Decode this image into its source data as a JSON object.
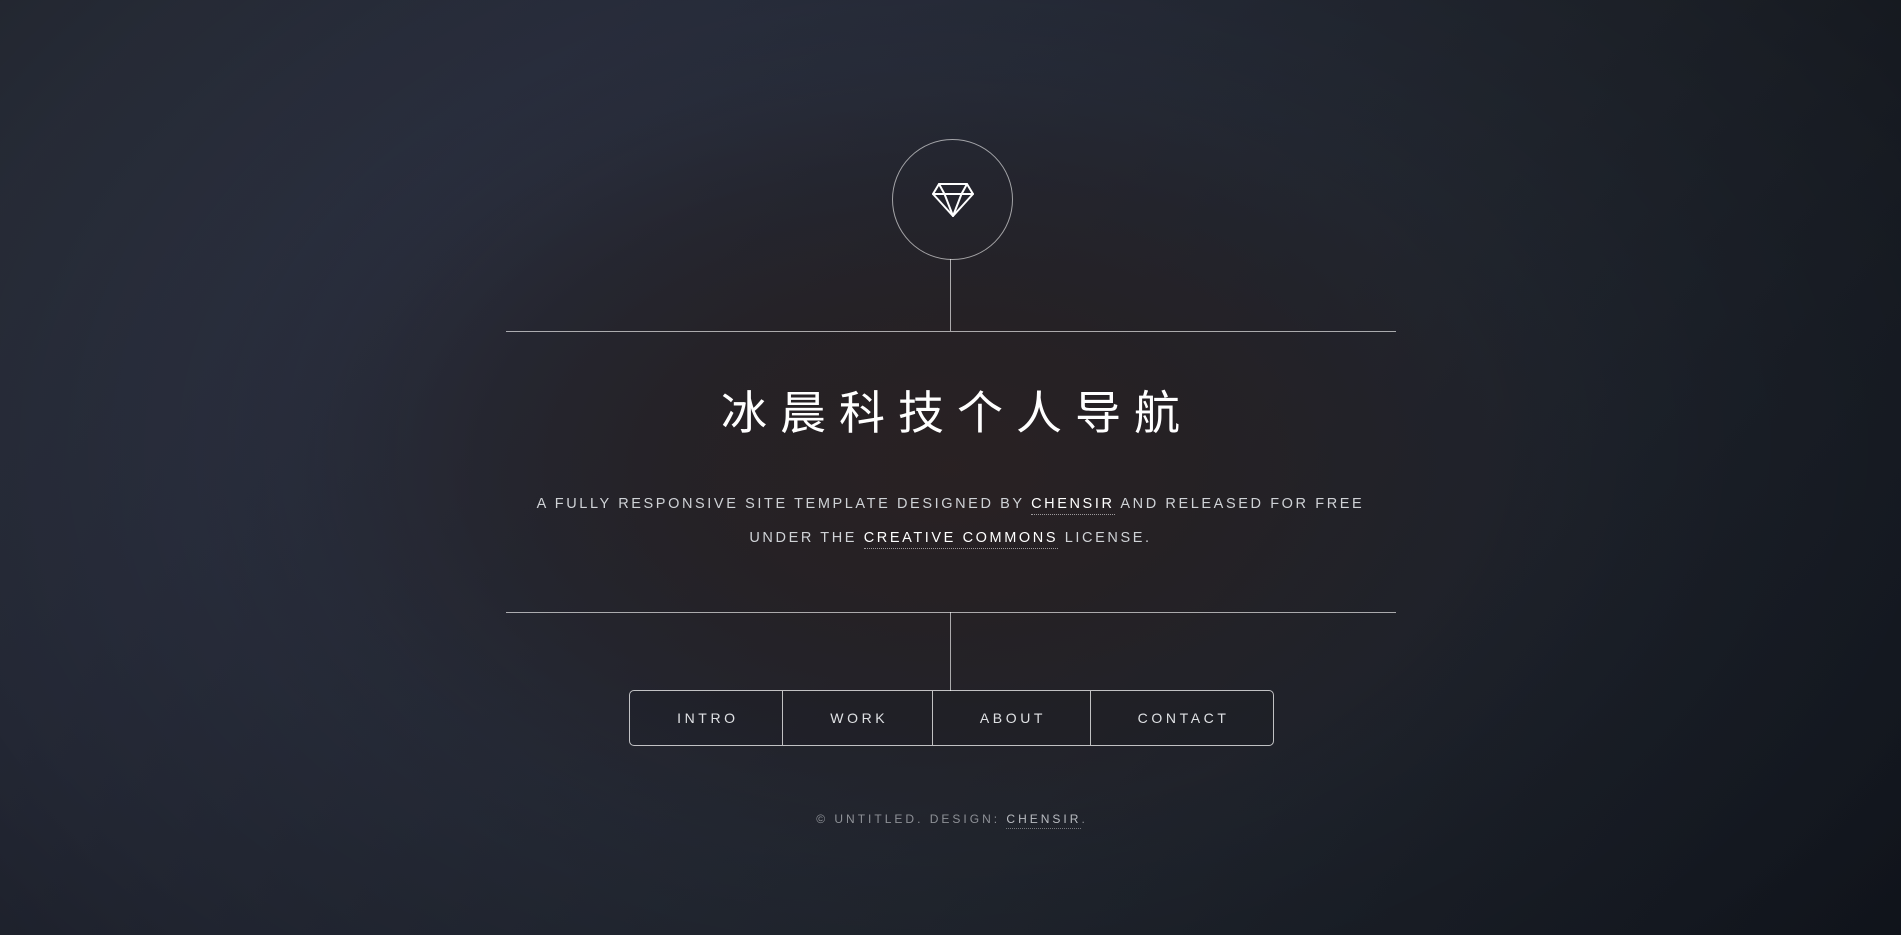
{
  "page": {
    "background_top_left": "#2f3542",
    "background_bottom_right": "#161b25",
    "background_center_glow": "#29212 2",
    "rule_color": "#ffffff"
  },
  "logo": {
    "icon": "diamond-icon",
    "shape": "circle"
  },
  "hero": {
    "title": "冰晨科技个人导航",
    "subtitle": {
      "part1": "A fully responsive site template designed by ",
      "link1": "Chensir",
      "part2": " and released for free under the ",
      "link2": "Creative Commons",
      "part3": " license."
    }
  },
  "nav": {
    "items": [
      {
        "label": "Intro"
      },
      {
        "label": "Work"
      },
      {
        "label": "About"
      },
      {
        "label": "Contact"
      }
    ]
  },
  "footer": {
    "prefix": "© Untitled. Design: ",
    "link": "Chensir",
    "suffix": "."
  }
}
